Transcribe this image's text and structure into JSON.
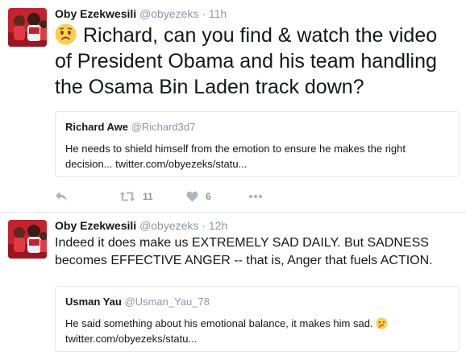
{
  "tweets": [
    {
      "author_name": "Oby Ezekwesili",
      "author_handle": "@obyezeks",
      "separator": "·",
      "time": "11h",
      "avatar_icon": "profile-photo",
      "emoji_icon": "worried-face-emoji",
      "text": "Richard, can you find & watch the video of President Obama and his team handling the Osama Bin Laden track down?",
      "quoted": {
        "author_name": "Richard Awe",
        "author_handle": "@Richard3d7",
        "text": "He needs to shield himself from the emotion to ensure he makes the right decision... twitter.com/obyezeks/statu..."
      },
      "actions": {
        "reply_icon": "reply-icon",
        "retweet_icon": "retweet-icon",
        "retweet_count": "11",
        "like_icon": "heart-icon",
        "like_count": "6",
        "more_icon": "more-icon"
      }
    },
    {
      "author_name": "Oby Ezekwesili",
      "author_handle": "@obyezeks",
      "separator": "·",
      "time": "12h",
      "avatar_icon": "profile-photo",
      "text": "Indeed it does make us EXTREMELY SAD DAILY. But SADNESS becomes EFFECTIVE ANGER -- that is, Anger that fuels ACTION.",
      "quoted": {
        "author_name": "Usman Yau",
        "author_handle": "@Usman_Yau_78",
        "text": "He said something about his emotional balance, it makes him sad.",
        "emoji_icon": "thinking-face-emoji",
        "link": "twitter.com/obyezeks/statu..."
      }
    }
  ],
  "colors": {
    "text": "#14171a",
    "secondary": "#8899a6",
    "action_icon": "#aab8c2",
    "border": "#e1e8ed",
    "avatar_red": "#c8212d"
  }
}
